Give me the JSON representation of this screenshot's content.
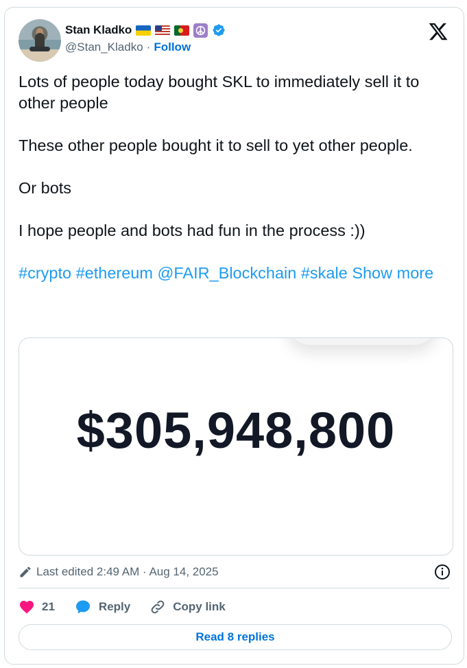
{
  "author": {
    "name": "Stan Kladko",
    "handle": "@Stan_Kladko",
    "separator": "·",
    "follow_label": "Follow",
    "badges": [
      "ukraine-flag",
      "usa-flag",
      "portugal-flag",
      "peace-symbol",
      "verified-badge"
    ]
  },
  "tweet": {
    "paragraphs": [
      "Lots of people today bought SKL to immediately sell it to other people",
      "These other people bought it to sell to yet other people.",
      "Or bots",
      "I hope people and bots had fun in the process :))"
    ],
    "tags": [
      "#crypto",
      "#ethereum",
      "@FAIR_Blockchain",
      "#skale"
    ],
    "show_more": "Show more"
  },
  "media": {
    "amount": "$305,948,800"
  },
  "meta": {
    "edited": "Last edited 2:49 AM · Aug 14, 2025"
  },
  "actions": {
    "likes": "21",
    "reply": "Reply",
    "copy_link": "Copy link"
  },
  "read_replies": "Read 8 replies",
  "colors": {
    "accent": "#1d9bf0",
    "link_dark": "#0074d9",
    "like": "#f91880",
    "muted": "#536471"
  }
}
